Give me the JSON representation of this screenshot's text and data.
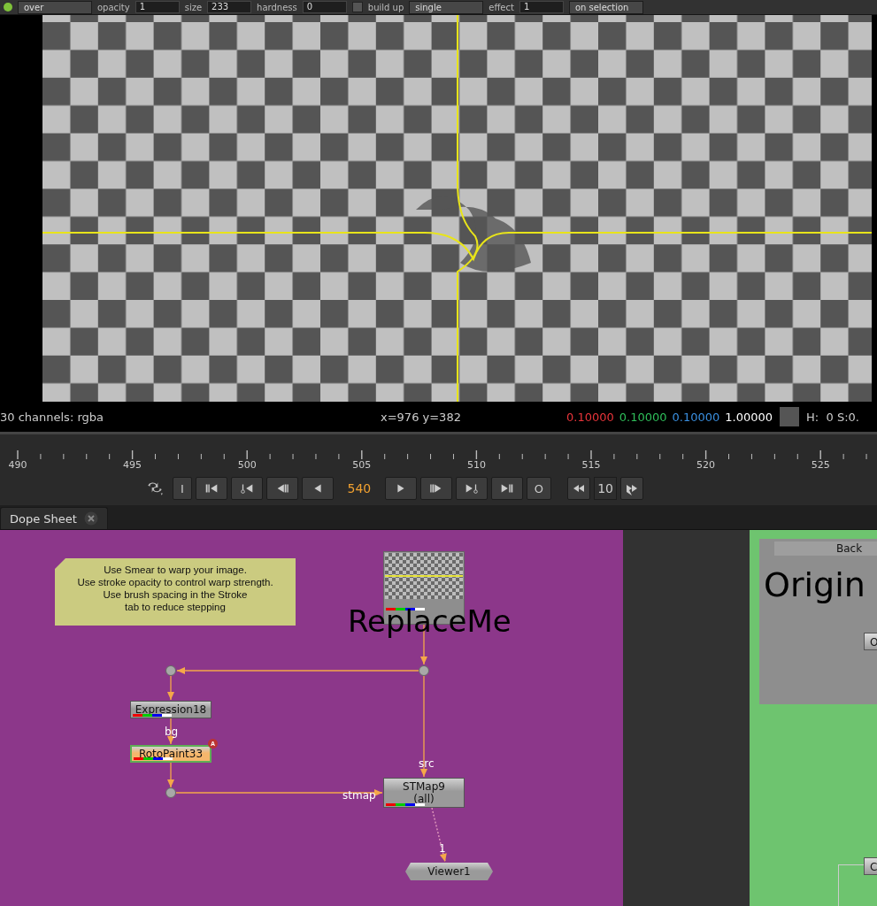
{
  "tool_options": [
    {
      "kind": "dropdown",
      "value": "over"
    },
    {
      "kind": "field",
      "label": "opacity",
      "value": "1"
    },
    {
      "kind": "field",
      "label": "size",
      "value": "233"
    },
    {
      "kind": "field",
      "label": "hardness",
      "value": "0"
    },
    {
      "kind": "toggle",
      "label": "build up"
    },
    {
      "kind": "dropdown",
      "value": "single"
    },
    {
      "kind": "field",
      "label": "effect",
      "value": "1"
    },
    {
      "kind": "dropdown",
      "value": "on selection"
    }
  ],
  "info_bar": {
    "channels": "30 channels: rgba",
    "coords": "x=976 y=382",
    "pixel": [
      {
        "value": "0.10000",
        "color": "#e8343a"
      },
      {
        "value": "0.10000",
        "color": "#2fbf5a"
      },
      {
        "value": "0.10000",
        "color": "#3a8fe0"
      },
      {
        "value": "1.00000",
        "color": "#ffffff"
      }
    ],
    "hsv": "H:  0 S:0."
  },
  "timeline": {
    "ticks": [
      "490",
      "495",
      "500",
      "505",
      "510",
      "515",
      "520",
      "525"
    ],
    "controls": [
      {
        "kind": "loop"
      },
      {
        "kind": "in",
        "label": "I"
      },
      {
        "kind": "first"
      },
      {
        "kind": "prev-key"
      },
      {
        "kind": "prev-frame"
      },
      {
        "kind": "play-back"
      },
      {
        "kind": "frame",
        "value": "540"
      },
      {
        "kind": "play"
      },
      {
        "kind": "next-frame"
      },
      {
        "kind": "next-key"
      },
      {
        "kind": "last"
      },
      {
        "kind": "out",
        "label": "O"
      },
      {
        "kind": "back-inc"
      },
      {
        "kind": "increment",
        "value": "10"
      },
      {
        "kind": "fwd-inc"
      }
    ]
  },
  "tabs": [
    {
      "label": "Dope Sheet",
      "selected": true
    }
  ],
  "node_graph": {
    "sticky_note": [
      "Use Smear to warp your image.",
      "Use stroke opacity to control warp strength.",
      "Use brush spacing in the Stroke",
      "tab to reduce stepping"
    ],
    "nodes": [
      {
        "kind": "thumbnail",
        "label": "ReplaceMe",
        "color": "#9a9a9a"
      },
      {
        "kind": "node",
        "label": "Expression18",
        "color": "#9a9a9a"
      },
      {
        "kind": "node",
        "label": "RotoPaint33",
        "color": "#f5b66c",
        "badge": "A"
      },
      {
        "kind": "node",
        "label": "STMap9",
        "sublabel": "(all)",
        "color": "#9a9a9a"
      },
      {
        "kind": "viewer",
        "label": "Viewer1",
        "color": "#9a9a9a"
      }
    ],
    "pipe_labels": [
      "bg",
      "src",
      "stmap",
      "1"
    ],
    "backdrop": {
      "title": "Back",
      "label": "Origin",
      "nodes": [
        "O",
        "C"
      ]
    }
  }
}
